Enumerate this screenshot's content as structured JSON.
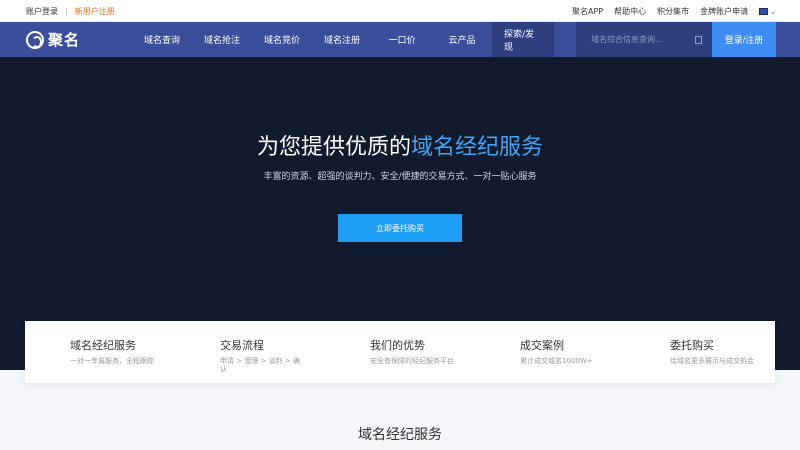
{
  "topbar": {
    "login": "账户登录",
    "separator": "|",
    "register": "新用户注册",
    "links": [
      "聚名APP",
      "帮助中心",
      "积分集市",
      "金牌账户申请"
    ]
  },
  "nav": {
    "logo_text": "聚名",
    "items": [
      {
        "label": "域名查询"
      },
      {
        "label": "域名抢注"
      },
      {
        "label": "域名竞价"
      },
      {
        "label": "域名注册"
      },
      {
        "label": "一口价"
      },
      {
        "label": "云产品"
      },
      {
        "label": "探索/发现"
      }
    ],
    "search_placeholder": "域名综合信息查询...",
    "login_button": "登录/注册"
  },
  "hero": {
    "title_prefix": "为您提供优质的",
    "title_highlight": "域名经纪服务",
    "subtitle": "丰富的资源、超强的谈判力、安全/便捷的交易方式、一对一贴心服务",
    "button": "立即委托购买"
  },
  "features": [
    {
      "title": "域名经纪服务",
      "desc": "一对一专属服务，全程跟踪"
    },
    {
      "title": "交易流程",
      "desc_line1": "申请 > 受理 > 谈判 > 确",
      "desc_line2": "认"
    },
    {
      "title": "我们的优势",
      "desc": "安全有保障的经纪服务平台"
    },
    {
      "title": "成交案例",
      "desc": "累计成交域名1000W+"
    },
    {
      "title": "委托购买",
      "desc": "给域名更多展示与成交机会"
    }
  ],
  "section": {
    "title": "域名经纪服务"
  },
  "colors": {
    "nav_bg": "#3a4e9c",
    "hero_bg": "#121b2e",
    "accent": "#1f9ef6",
    "register": "#f06a1e"
  }
}
